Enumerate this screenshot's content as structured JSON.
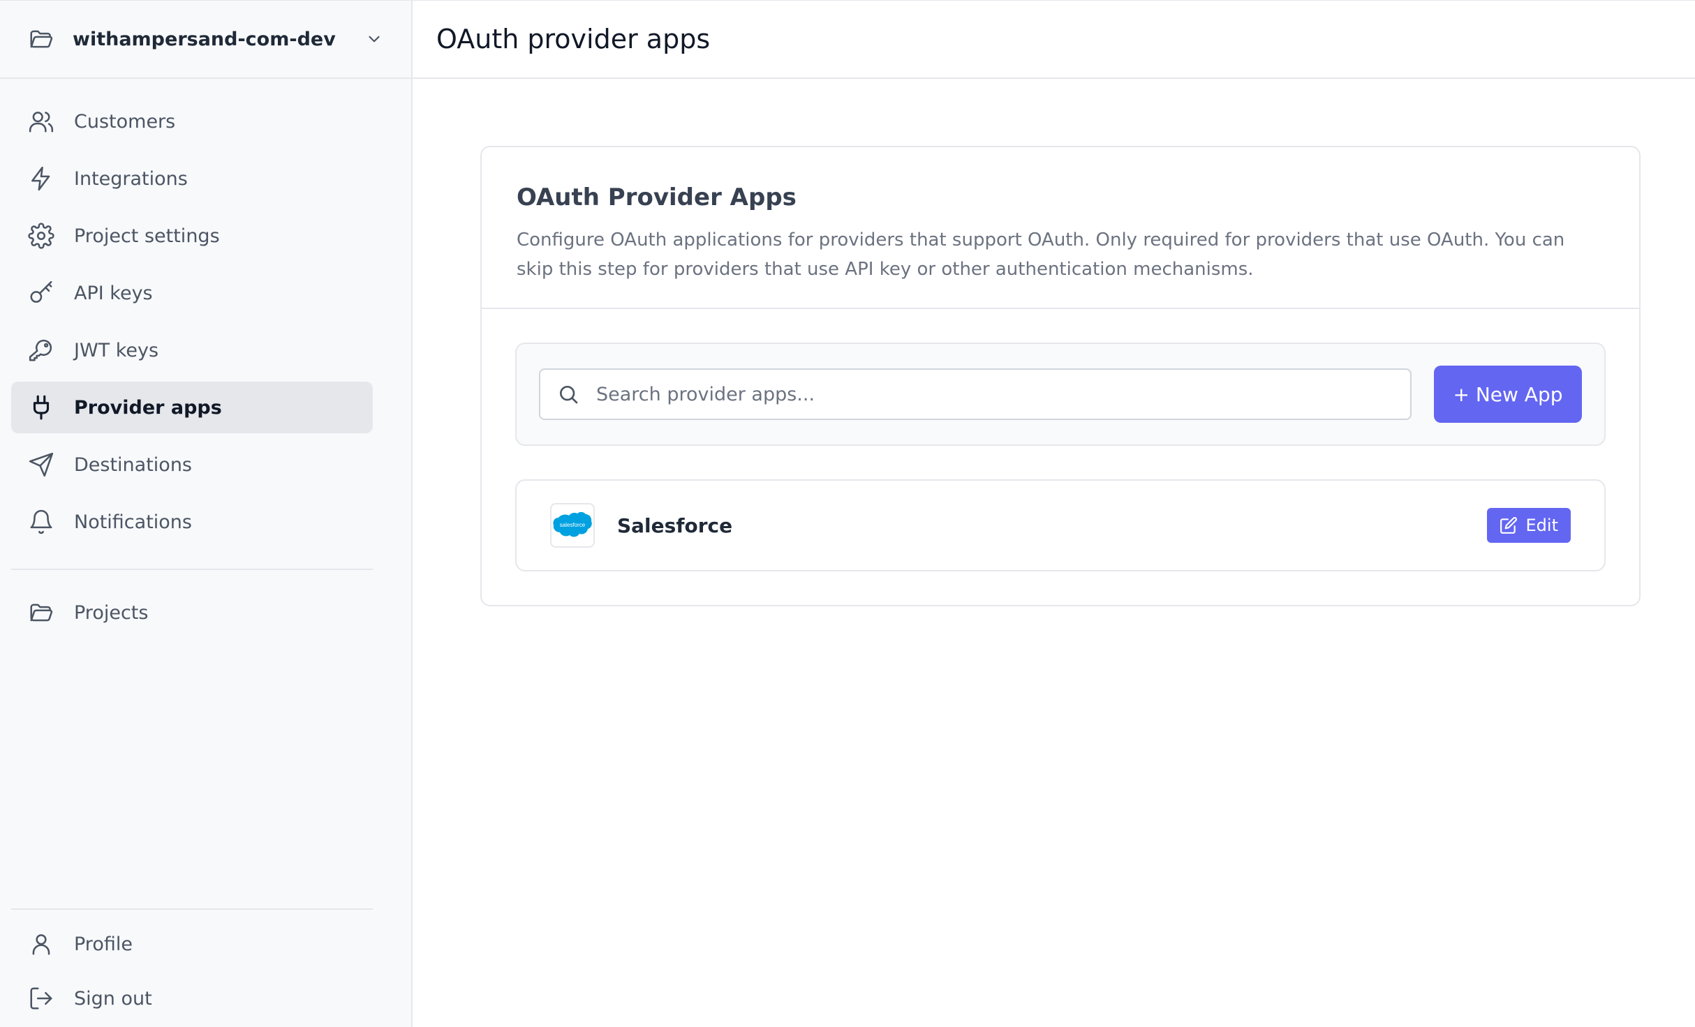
{
  "sidebar": {
    "project": {
      "name": "withampersand-com-dev",
      "icon": "folder-open-icon",
      "chevron": "chevron-down-icon"
    },
    "items": [
      {
        "label": "Customers",
        "icon": "users-icon"
      },
      {
        "label": "Integrations",
        "icon": "lightning-bolt-icon"
      },
      {
        "label": "Project settings",
        "icon": "gear-icon"
      },
      {
        "label": "API keys",
        "icon": "key-icon"
      },
      {
        "label": "JWT keys",
        "icon": "key-round-icon"
      },
      {
        "label": "Provider apps",
        "icon": "plug-icon",
        "active": true
      },
      {
        "label": "Destinations",
        "icon": "send-icon"
      },
      {
        "label": "Notifications",
        "icon": "bell-icon"
      }
    ],
    "projects": {
      "label": "Projects",
      "icon": "folder-open-icon"
    },
    "bottom": [
      {
        "label": "Profile",
        "icon": "user-icon"
      },
      {
        "label": "Sign out",
        "icon": "sign-out-icon"
      }
    ]
  },
  "header": {
    "title": "OAuth provider apps"
  },
  "card": {
    "title": "OAuth Provider Apps",
    "description": "Configure OAuth applications for providers that support OAuth. Only required for providers that use OAuth. You can skip this step for providers that use API key or other authentication mechanisms.",
    "search": {
      "placeholder": "Search provider apps..."
    },
    "new_app_label": "+ New App",
    "apps": [
      {
        "name": "Salesforce",
        "logo": "salesforce-logo",
        "logo_text": "salesforce",
        "edit_label": "Edit"
      }
    ]
  },
  "colors": {
    "accent": "#6366f1",
    "sidebar_bg": "#f8f9fb",
    "active_bg": "#e5e7eb",
    "salesforce": "#00a1e0"
  }
}
